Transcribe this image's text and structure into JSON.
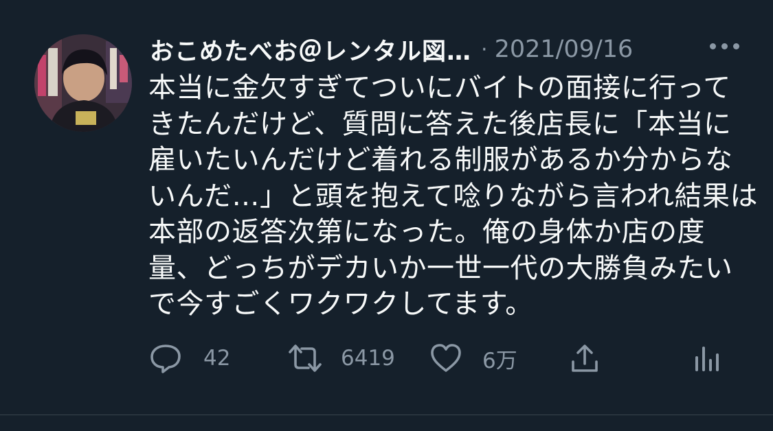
{
  "tweet": {
    "display_name": "おこめたべお＠レンタル図…",
    "separator": "·",
    "date": "2021/09/16",
    "body_lines": [
      "本当に金欠すぎてついにバイトの面接に行って",
      "きたんだけど、質問に答えた後店長に「本当に",
      "雇いたいんだけど着れる制服があるか分からな",
      "いんだ…」と頭を抱えて唸りながら言われ結果は",
      "本部の返答次第になった。俺の身体か店の度",
      "量、どっちがデカいか一世一代の大勝負みたい",
      "で今すごくワクワクしてます。"
    ],
    "actions": {
      "reply_count": "42",
      "retweet_count": "6419",
      "like_count": "6万"
    }
  },
  "colors": {
    "background": "#15202b",
    "primary_text": "#f7f9f9",
    "secondary_text": "#8b98a5",
    "divider": "#38444d"
  },
  "icons": {
    "avatar": "avatar",
    "more": "more-horizontal-icon",
    "reply": "reply-icon",
    "retweet": "retweet-icon",
    "like": "heart-icon",
    "share": "share-icon",
    "analytics": "analytics-icon"
  }
}
